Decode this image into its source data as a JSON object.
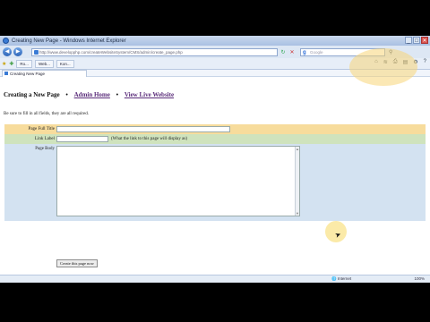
{
  "window": {
    "title": "Creating New Page - Windows Internet Explorer",
    "controls": [
      "_",
      "□",
      "✕"
    ]
  },
  "addressbar": {
    "url": "http://www.developphp.com/createWebsiteSystem/CMS/admin/create_page.php",
    "search_placeholder": "Google",
    "back_icon": "back-arrow-icon",
    "forward_icon": "forward-arrow-icon"
  },
  "tabs": {
    "buttons": [
      "Ro...",
      "Web...",
      "Kon..."
    ],
    "current_tab": "Creating New Page"
  },
  "page": {
    "heading": "Creating a New Page",
    "bullet": "•",
    "links": {
      "admin_home": "Admin Home",
      "view_live": "View Live Website"
    },
    "instructions": "Be sure to fill in all fields, they are all required.",
    "form": {
      "title_label": "Page Full Title",
      "link_label": "Link Label",
      "link_hint": "(What the link to this page will display as)",
      "body_label": "Page Body",
      "submit_label": "Create this page now"
    }
  },
  "statusbar": {
    "text": "",
    "zone": "Internet",
    "zoom": "100%"
  },
  "colors": {
    "title_row": "#f7dc9c",
    "link_row": "#cfe3bd",
    "body_row": "#d3e2f1",
    "link_color": "#5a2c7a"
  }
}
